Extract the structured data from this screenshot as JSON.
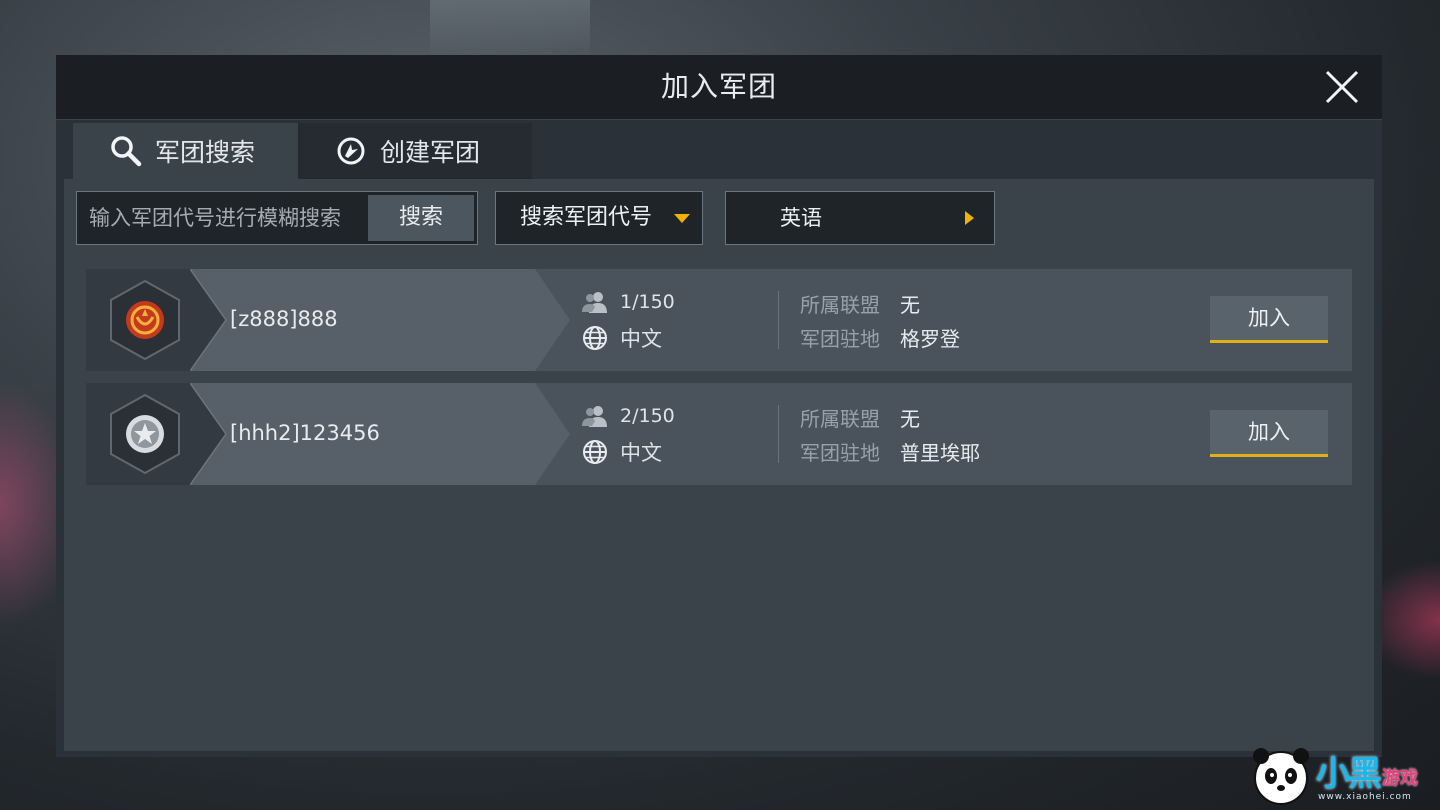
{
  "dialog": {
    "title": "加入军团"
  },
  "tabs": [
    {
      "label": "军团搜索",
      "icon": "search-icon",
      "active": true
    },
    {
      "label": "创建军团",
      "icon": "create-legion-icon",
      "active": false
    }
  ],
  "search": {
    "placeholder": "输入军团代号进行模糊搜索",
    "value": "",
    "button_label": "搜索"
  },
  "filter": {
    "mode_selected": "搜索军团代号",
    "language_selected": "英语"
  },
  "colors": {
    "accent": "#f0b400",
    "panel": "#3a424a",
    "row": "#4a535c"
  },
  "legions": [
    {
      "name": "[z888]888",
      "members": "1/150",
      "language": "中文",
      "alliance_label": "所属联盟",
      "alliance": "无",
      "base_label": "军团驻地",
      "base": "格罗登",
      "join_label": "加入",
      "emblem": "red-laurel-emblem"
    },
    {
      "name": "[hhh2]123456",
      "members": "2/150",
      "language": "中文",
      "alliance_label": "所属联盟",
      "alliance": "无",
      "base_label": "军团驻地",
      "base": "普里埃耶",
      "join_label": "加入",
      "emblem": "silver-star-emblem"
    }
  ],
  "watermark": {
    "text": "小黑",
    "text2": "游戏",
    "url": "www.xiaohei.com"
  }
}
